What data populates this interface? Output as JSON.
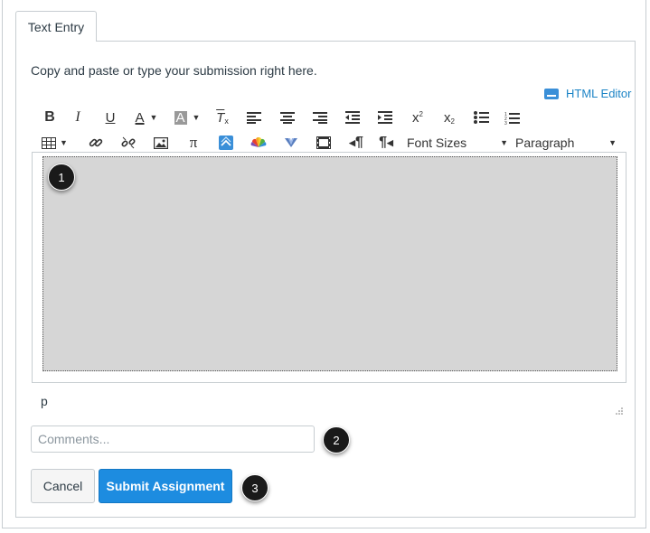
{
  "tab": {
    "label": "Text Entry"
  },
  "instructions": "Copy and paste or type your submission right here.",
  "html_editor": {
    "label": "HTML Editor",
    "icon": "keyboard-icon"
  },
  "toolbar": {
    "row1": [
      "bold-icon",
      "italic-icon",
      "underline-icon",
      "text-color-icon",
      "background-color-icon",
      "clear-formatting-icon",
      "align-left-icon",
      "align-center-icon",
      "align-right-icon",
      "outdent-icon",
      "indent-icon",
      "superscript-icon",
      "subscript-icon",
      "bullet-list-icon",
      "numbered-list-icon"
    ],
    "row2": [
      "table-icon",
      "link-icon",
      "unlink-icon",
      "image-icon",
      "math-icon",
      "apps-icon",
      "media-icon",
      "video-icon",
      "embed-icon",
      "ltr-icon",
      "rtl-icon"
    ],
    "font_sizes": "Font Sizes",
    "paragraph": "Paragraph"
  },
  "editor": {
    "path": "p"
  },
  "comments": {
    "placeholder": "Comments..."
  },
  "buttons": {
    "cancel": "Cancel",
    "submit": "Submit Assignment"
  },
  "callouts": {
    "one": "1",
    "two": "2",
    "three": "3"
  },
  "colors": {
    "link": "#1c84c6",
    "submit_bg": "#1d8ce0",
    "editor_bg": "#d6d6d6",
    "border": "#c7cdd1"
  }
}
